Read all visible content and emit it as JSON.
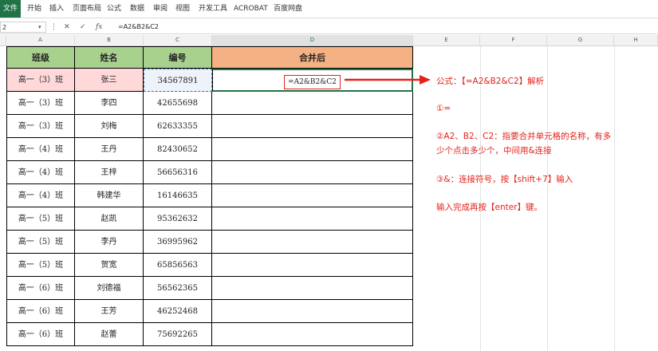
{
  "ribbon": {
    "file": "文件",
    "tabs": [
      "开始",
      "插入",
      "页面布局",
      "公式",
      "数据",
      "审阅",
      "视图",
      "开发工具",
      "ACROBAT",
      "百度网盘"
    ]
  },
  "formula_bar": {
    "name_box": "2",
    "cancel_icon": "✕",
    "confirm_icon": "✓",
    "fx": "fx",
    "formula": "=A2&B2&C2"
  },
  "columns": [
    "A",
    "B",
    "C",
    "D",
    "E",
    "F",
    "G",
    "H"
  ],
  "table": {
    "headers": [
      "班级",
      "姓名",
      "编号",
      "合并后"
    ],
    "rows": [
      [
        "高一（3）班",
        "张三",
        "34567891"
      ],
      [
        "高一（3）班",
        "李四",
        "42655698"
      ],
      [
        "高一（3）班",
        "刘梅",
        "62633355"
      ],
      [
        "高一（4）班",
        "王丹",
        "82430652"
      ],
      [
        "高一（4）班",
        "王梓",
        "56656316"
      ],
      [
        "高一（4）班",
        "韩建华",
        "16146635"
      ],
      [
        "高一（5）班",
        "赵凯",
        "95362632"
      ],
      [
        "高一（5）班",
        "李丹",
        "36995962"
      ],
      [
        "高一（5）班",
        "贺宽",
        "65856563"
      ],
      [
        "高一（6）班",
        "刘德福",
        "56562365"
      ],
      [
        "高一（6）班",
        "王芳",
        "46252468"
      ],
      [
        "高一（6）班",
        "赵蕾",
        "75692265"
      ]
    ],
    "editing_cell": "=A2&B2&C2"
  },
  "annotation": {
    "title": "公式：【=A2&B2&C2】解析",
    "step1": "①=",
    "step2_line1": "②A2、B2、C2：指要合并单元格的名称，有多",
    "step2_line2": "少个点击多少个，中间用&连接",
    "step3": "③&：连接符号，按【shift+7】输入",
    "step4": "输入完成再按【enter】键。"
  },
  "colors": {
    "header_green": "#a9d18e",
    "header_orange": "#f4b183",
    "selected_red": "#ffd9d9",
    "accent_red": "#e2231a",
    "excel_green": "#217346"
  }
}
